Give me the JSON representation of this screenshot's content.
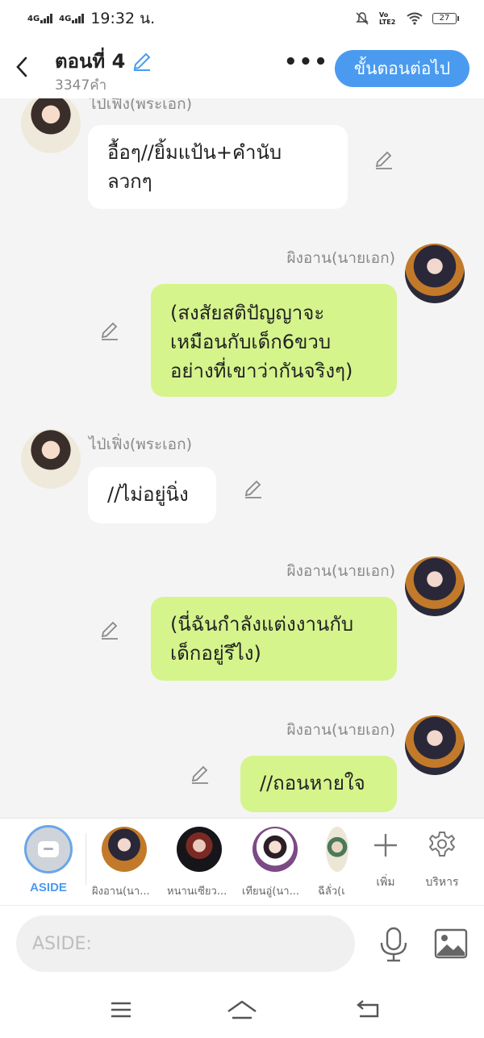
{
  "status_bar": {
    "network_1": "4G",
    "network_2": "4G",
    "time": "19:32 น.",
    "volte": "Vo LTE2",
    "battery": "27"
  },
  "header": {
    "back_icon": "chevron-left-icon",
    "title": "ตอนที่ 4",
    "word_count": "3347คำ",
    "more_label": "•••",
    "next_button": "ขั้นตอนต่อไป",
    "accent_color": "#4a9bf0"
  },
  "messages": [
    {
      "side": "left",
      "sender": "ไป่เฟิ่ง(พระเอก)",
      "text_lines": [
        "อื้อๆ//ยิ้มแป้น+คำนับ",
        "ลวกๆ"
      ]
    },
    {
      "side": "right",
      "sender": "ผิงอาน(นายเอก)",
      "text_lines": [
        "(สงสัยสติปัญญาจะ",
        "เหมือนกับเด็ก6ขวบ",
        "อย่างที่เขาว่ากันจริงๆ)"
      ]
    },
    {
      "side": "left",
      "sender": "ไป่เฟิ่ง(พระเอก)",
      "text_lines": [
        "//ไม่อยู่นิ่ง"
      ]
    },
    {
      "side": "right",
      "sender": "ผิงอาน(นายเอก)",
      "text_lines": [
        "(นี่ฉันกำลังแต่งงานกับ",
        "เด็กอยู่รึไง)"
      ]
    },
    {
      "side": "right",
      "sender": "ผิงอาน(นายเอก)",
      "text_lines": [
        "//ถอนหายใจ"
      ]
    }
  ],
  "character_bar": {
    "aside_label": "ASIDE",
    "characters": [
      {
        "label": "ผิงอาน(นา..."
      },
      {
        "label": "หนานเซียว..."
      },
      {
        "label": "เทียนอู่(นา..."
      },
      {
        "label": "ฉีลั่ว(เ"
      }
    ],
    "add_label": "เพิ่ม",
    "manage_label": "บริหาร"
  },
  "composer": {
    "placeholder": "ASIDE:"
  },
  "colors": {
    "left_bubble": "#ffffff",
    "right_bubble": "#d5f48c",
    "background": "#f4f4f4"
  }
}
